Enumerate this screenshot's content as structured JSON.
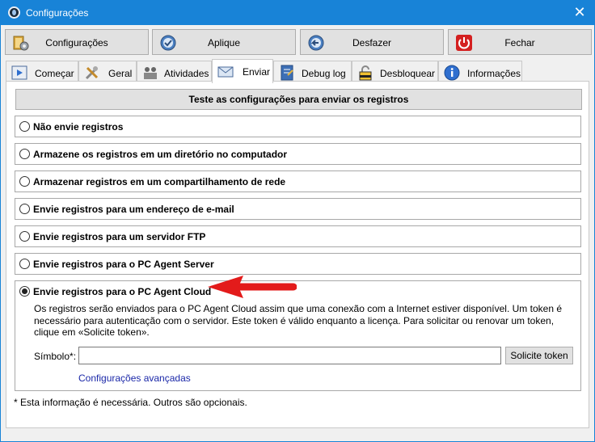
{
  "window": {
    "title": "Configurações",
    "close_glyph": "✕"
  },
  "toolbar": {
    "settings_label": "Configurações",
    "apply_label": "Aplique",
    "undo_label": "Desfazer",
    "close_label": "Fechar"
  },
  "tabs": [
    {
      "label": "Começar",
      "icon": "play-icon"
    },
    {
      "label": "Geral",
      "icon": "tools-icon"
    },
    {
      "label": "Atividades",
      "icon": "people-icon"
    },
    {
      "label": "Enviar",
      "icon": "mail-icon",
      "active": true
    },
    {
      "label": "Debug log",
      "icon": "notebook-icon"
    },
    {
      "label": "Desbloquear",
      "icon": "lock-icon"
    },
    {
      "label": "Informações",
      "icon": "info-icon"
    }
  ],
  "panel": {
    "test_button": "Teste as configurações para enviar os registros",
    "options": [
      {
        "label": "Não envie registros",
        "checked": false
      },
      {
        "label": "Armazene os registros em um diretório no computador",
        "checked": false
      },
      {
        "label": "Armazenar registros em um compartilhamento de rede",
        "checked": false
      },
      {
        "label": "Envie registros para um endereço de e-mail",
        "checked": false
      },
      {
        "label": "Envie registros para um servidor FTP",
        "checked": false
      },
      {
        "label": "Envie registros para o PC Agent Server",
        "checked": false
      },
      {
        "label": "Envie registros para o PC Agent Cloud",
        "checked": true
      }
    ],
    "cloud": {
      "description": "Os registros serão enviados para o PC Agent Cloud assim que uma conexão com a Internet estiver disponível. Um token é necessário para autenticação com o servidor. Este token é válido enquanto a licença. Para solicitar ou renovar um token, clique em «Solicite token».",
      "symbol_label": "Símbolo*:",
      "symbol_value": "",
      "request_token_label": "Solicite token",
      "advanced_link": "Configurações avançadas"
    },
    "footnote": "* Esta informação é necessária. Outros são opcionais."
  },
  "colors": {
    "titlebar": "#1883d7",
    "link": "#1a27a8",
    "annotation_arrow": "#e31b1b"
  }
}
